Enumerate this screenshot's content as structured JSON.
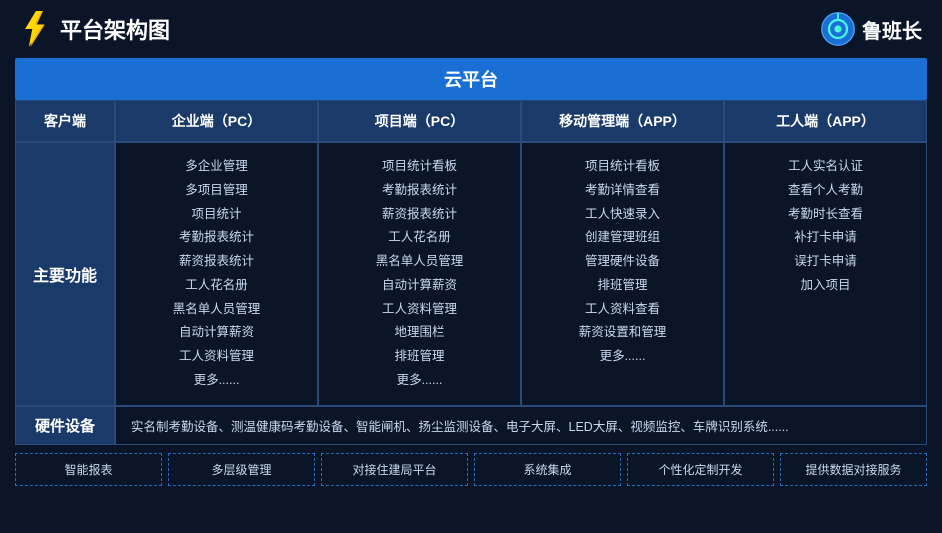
{
  "header": {
    "title": "平台架构图",
    "brand": "鲁班长"
  },
  "cloud_platform": "云平台",
  "columns": {
    "client": "客户端",
    "enterprise": "企业端（PC）",
    "project": "项目端（PC）",
    "mobile": "移动管理端（APP）",
    "worker": "工人端（APP）"
  },
  "main_function_label": "主要功能",
  "enterprise_items": [
    "多企业管理",
    "多项目管理",
    "项目统计",
    "考勤报表统计",
    "薪资报表统计",
    "工人花名册",
    "黑名单人员管理",
    "自动计算薪资",
    "工人资料管理",
    "更多......"
  ],
  "project_items": [
    "项目统计看板",
    "考勤报表统计",
    "薪资报表统计",
    "工人花名册",
    "黑名单人员管理",
    "自动计算薪资",
    "工人资料管理",
    "地理围栏",
    "排班管理",
    "更多......"
  ],
  "mobile_items": [
    "项目统计看板",
    "考勤详情查看",
    "工人快速录入",
    "创建管理班组",
    "管理硬件设备",
    "排班管理",
    "工人资料查看",
    "薪资设置和管理",
    "更多......"
  ],
  "worker_items": [
    "工人实名认证",
    "查看个人考勤",
    "考勤时长查看",
    "补打卡申请",
    "误打卡申请",
    "加入项目"
  ],
  "hardware_label": "硬件设备",
  "hardware_content": "实名制考勤设备、测温健康码考勤设备、智能闸机、扬尘监测设备、电子大屏、LED大屏、视频监控、车牌识别系统......",
  "features": [
    "智能报表",
    "多层级管理",
    "对接住建局平台",
    "系统集成",
    "个性化定制开发",
    "提供数据对接服务"
  ]
}
